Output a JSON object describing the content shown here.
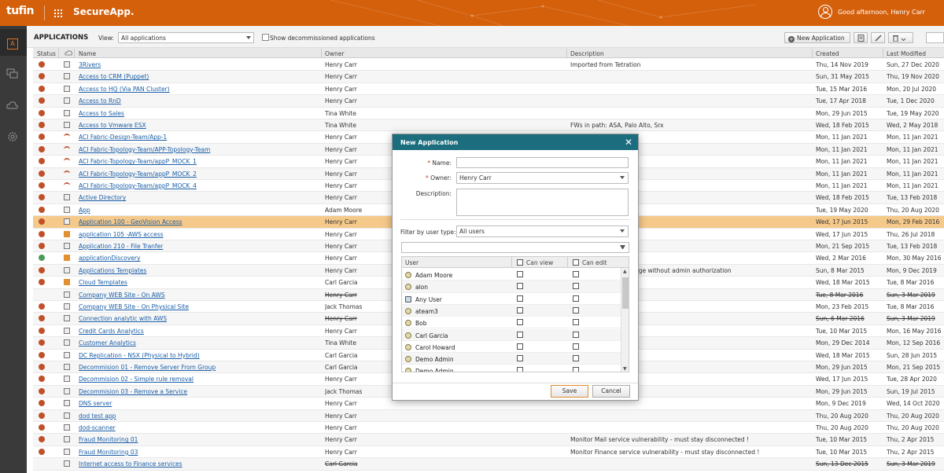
{
  "topbar": {
    "logo": "tufin",
    "app_name": "SecureApp.",
    "greeting": "Good afternoon, Henry Carr",
    "bg_color": "#d4600c"
  },
  "sidebar": {
    "items": [
      {
        "icon": "applications-icon",
        "active": true
      },
      {
        "icon": "chat-icon"
      },
      {
        "icon": "cloud-icon"
      },
      {
        "icon": "gear-icon"
      }
    ]
  },
  "pagebar": {
    "title": "APPLICATIONS",
    "view_label": "View:",
    "view_value": "All applications",
    "show_decommissioned_label": "Show decommissioned applications",
    "new_app_label": "New Application"
  },
  "table": {
    "headers": [
      "Status",
      "",
      "Name",
      "Owner",
      "Description",
      "Created",
      "Last Modified"
    ],
    "rows": [
      {
        "name": "3Rivers",
        "owner": "Henry Carr",
        "description": "Imported from Tetration",
        "created": "Thu, 14 Nov 2019",
        "modified": "Sun, 27 Dec 2020"
      },
      {
        "name": "Access to CRM (Puppet)",
        "owner": "Henry Carr",
        "description": "",
        "created": "Sun, 31 May 2015",
        "modified": "Thu, 19 Nov 2020"
      },
      {
        "name": "Access to HQ (Via PAN Cluster)",
        "owner": "Henry Carr",
        "description": "",
        "created": "Tue, 15 Mar 2016",
        "modified": "Mon, 20 Jul 2020"
      },
      {
        "name": "Access to RnD",
        "owner": "Henry Carr",
        "description": "",
        "created": "Tue, 17 Apr 2018",
        "modified": "Tue, 1 Dec 2020"
      },
      {
        "name": "Access to Sales",
        "owner": "Tina White",
        "description": "",
        "created": "Mon, 29 Jun 2015",
        "modified": "Tue, 19 May 2020"
      },
      {
        "name": "Access to Vmware ESX",
        "owner": "Tina White",
        "description": "FWs in path: ASA, Palo Alto, Srx",
        "created": "Wed, 18 Feb 2015",
        "modified": "Wed, 2 May 2018"
      },
      {
        "name": "ACI Fabric-Design-Team/App-1",
        "owner": "Henry Carr",
        "description": "",
        "created": "Mon, 11 Jan 2021",
        "modified": "Mon, 11 Jan 2021"
      },
      {
        "name": "ACI Fabric-Topology-Team/APP-Topology-Team",
        "owner": "Henry Carr",
        "description": "",
        "created": "Mon, 11 Jan 2021",
        "modified": "Mon, 11 Jan 2021"
      },
      {
        "name": "ACI Fabric-Topology-Team/appP_MOCK_1",
        "owner": "Henry Carr",
        "description": "",
        "created": "Mon, 11 Jan 2021",
        "modified": "Mon, 11 Jan 2021"
      },
      {
        "name": "ACI Fabric-Topology-Team/appP_MOCK_2",
        "owner": "Henry Carr",
        "description": "",
        "created": "Mon, 11 Jan 2021",
        "modified": "Mon, 11 Jan 2021"
      },
      {
        "name": "ACI Fabric-Topology-Team/appP_MOCK_4",
        "owner": "Henry Carr",
        "description": "",
        "created": "Mon, 11 Jan 2021",
        "modified": "Mon, 11 Jan 2021"
      },
      {
        "name": "Active Directory",
        "owner": "Henry Carr",
        "description": "",
        "created": "Wed, 18 Feb 2015",
        "modified": "Tue, 13 Feb 2018"
      },
      {
        "name": "App",
        "owner": "Adam Moore",
        "description": "",
        "created": "Tue, 19 May 2020",
        "modified": "Thu, 20 Aug 2020"
      },
      {
        "name": "Application 100 - GeoVision Access",
        "owner": "Henry Carr",
        "description": "...to",
        "created": "Wed, 17 Jun 2015",
        "modified": "Mon, 29 Feb 2016"
      },
      {
        "name": "application 105 -AWS access",
        "owner": "Henry Carr",
        "description": "...o Alto",
        "created": "Wed, 17 Jun 2015",
        "modified": "Thu, 26 Jul 2018"
      },
      {
        "name": "Application 210 - File Tranfer",
        "owner": "Henry Carr",
        "description": "",
        "created": "Mon, 21 Sep 2015",
        "modified": "Tue, 13 Feb 2018"
      },
      {
        "name": "applicationDiscovery",
        "owner": "Henry Carr",
        "description": "...P",
        "created": "Wed, 2 Mar 2016",
        "modified": "Mon, 30 May 2016"
      },
      {
        "name": "Applications Templates",
        "owner": "Henry Carr",
        "description": "...mplates, do not change without admin authorization",
        "created": "Sun, 8 Mar 2015",
        "modified": "Mon, 9 Dec 2019"
      },
      {
        "name": "Cloud Templates",
        "owner": "Carl Garcia",
        "description": "",
        "created": "Wed, 18 Mar 2015",
        "modified": "Tue, 8 Mar 2016"
      },
      {
        "name": "Company WEB Site - On AWS",
        "owner": "Henry Carr",
        "description": "",
        "created": "Tue, 8 Mar 2016",
        "modified": "Sun, 3 Mar 2019",
        "decommissioned": true
      },
      {
        "name": "Company WEB Site - On Physical Site",
        "owner": "Jack Thomas",
        "description": "",
        "created": "Mon, 23 Feb 2015",
        "modified": "Tue, 8 Mar 2016"
      },
      {
        "name": "Connection analytic with AWS",
        "owner": "Henry Carr",
        "description": "...ving the traffic",
        "created": "Sun, 6 Mar 2016",
        "modified": "Sun, 3 Mar 2019",
        "decommissioned": true
      },
      {
        "name": "Credit Cards Analytics",
        "owner": "Henry Carr",
        "description": "",
        "created": "Tue, 10 Mar 2015",
        "modified": "Mon, 16 May 2016"
      },
      {
        "name": "Customer Analytics",
        "owner": "Tina White",
        "description": "",
        "created": "Mon, 29 Dec 2014",
        "modified": "Mon, 12 Sep 2016"
      },
      {
        "name": "DC Replication - NSX (Physical to Hybrid)",
        "owner": "Carl Garcia",
        "description": "...SX",
        "created": "Wed, 18 Mar 2015",
        "modified": "Sun, 28 Jun 2015"
      },
      {
        "name": "Decommision 01 - Remove Server From Group",
        "owner": "Carl Garcia",
        "description": "",
        "created": "Mon, 29 Jun 2015",
        "modified": "Mon, 21 Sep 2015"
      },
      {
        "name": "Decommision 02 - Simple rule removal",
        "owner": "Henry Carr",
        "description": "",
        "created": "Wed, 17 Jun 2015",
        "modified": "Tue, 28 Apr 2020"
      },
      {
        "name": "Decommision 03 - Remove a Service",
        "owner": "Jack Thomas",
        "description": "...SA, Palo Alto",
        "created": "Mon, 29 Jun 2015",
        "modified": "Sun, 19 Jul 2015"
      },
      {
        "name": "DNS server",
        "owner": "Henry Carr",
        "description": "",
        "created": "Mon, 9 Dec 2019",
        "modified": "Wed, 14 Oct 2020"
      },
      {
        "name": "dod test app",
        "owner": "Henry Carr",
        "description": "",
        "created": "Thu, 20 Aug 2020",
        "modified": "Thu, 20 Aug 2020"
      },
      {
        "name": "dod-scanner",
        "owner": "Henry Carr",
        "description": "",
        "created": "Thu, 20 Aug 2020",
        "modified": "Thu, 20 Aug 2020"
      },
      {
        "name": "Fraud Monitoring 01",
        "owner": "Henry Carr",
        "description": "Monitor Mail service vulnerability - must stay disconnected !",
        "created": "Tue, 10 Mar 2015",
        "modified": "Thu, 2 Apr 2015"
      },
      {
        "name": "Fraud Monitoring 03",
        "owner": "Henry Carr",
        "description": "Monitor Finance service vulnerability - must stay disconnected !",
        "created": "Tue, 10 Mar 2015",
        "modified": "Thu, 2 Apr 2015"
      },
      {
        "name": "Internet access to Finance services",
        "owner": "Carl Garcia",
        "description": "",
        "created": "Sun, 13 Dec 2015",
        "modified": "Sun, 3 Mar 2019",
        "decommissioned": true
      }
    ]
  },
  "modal": {
    "title": "New Application",
    "name_label": "Name:",
    "owner_label": "Owner:",
    "owner_value": "Henry Carr",
    "description_label": "Description:",
    "filter_label": "Filter by user type:",
    "filter_value": "All users",
    "col_user": "User",
    "col_can_view": "Can view",
    "col_can_edit": "Can edit",
    "users": [
      {
        "name": "Adam Moore",
        "type": "user"
      },
      {
        "name": "alon",
        "type": "user"
      },
      {
        "name": "Any User",
        "type": "group"
      },
      {
        "name": "ateam3",
        "type": "user"
      },
      {
        "name": "Bob",
        "type": "user"
      },
      {
        "name": "Carl Garcia",
        "type": "user"
      },
      {
        "name": "Carol Howard",
        "type": "user"
      },
      {
        "name": "Demo Admin",
        "type": "user"
      },
      {
        "name": "Demo Admin",
        "type": "user"
      }
    ],
    "save_label": "Save",
    "cancel_label": "Cancel",
    "header_color": "#1c6e7e"
  }
}
